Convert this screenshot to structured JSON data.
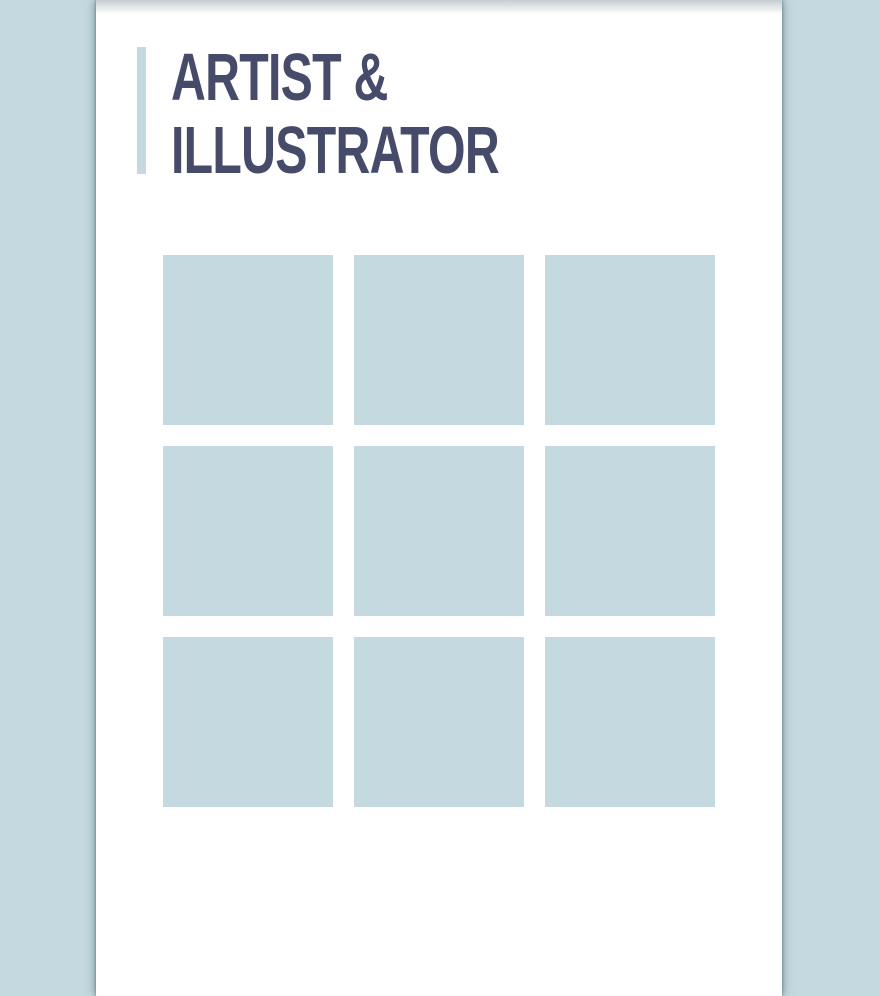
{
  "heading": {
    "line1": "Artist &",
    "line2": "Illustrator"
  },
  "colors": {
    "background": "#c4dae0",
    "page": "#ffffff",
    "title": "#474b6a",
    "accent_bar": "#c4dae0",
    "tile": "#c4dae0"
  },
  "gallery": {
    "rows": 3,
    "columns": 3,
    "tile_count": 9
  }
}
